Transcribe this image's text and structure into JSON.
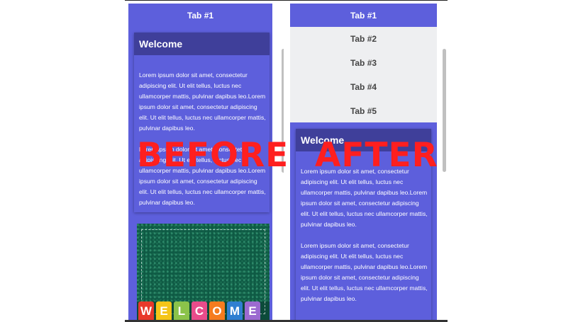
{
  "before": {
    "tab_label": "Tab #1",
    "card_title": "Welcome",
    "paragraphs": [
      "Lorem ipsum dolor sit amet, consectetur adipiscing elit. Ut elit tellus, luctus nec ullamcorper mattis, pulvinar dapibus leo.Lorem ipsum dolor sit amet, consectetur adipiscing elit. Ut elit tellus, luctus nec ullamcorper mattis, pulvinar dapibus leo.",
      "Lorem ipsum dolor sit amet, consectetur adipiscing elit. Ut elit tellus, luctus nec ullamcorper mattis, pulvinar dapibus leo.Lorem ipsum dolor sit amet, consectetur adipiscing elit. Ut elit tellus, luctus nec ullamcorper mattis, pulvinar dapibus leo."
    ],
    "image_letters": [
      "W",
      "E",
      "L",
      "C",
      "O",
      "M",
      "E"
    ],
    "image_letter_colors": [
      "#e8392b",
      "#f5c518",
      "#8bc34a",
      "#e84c8b",
      "#f57c1f",
      "#2f7fd1",
      "#9c6ad0"
    ],
    "label": "BEFORE"
  },
  "after": {
    "tabs": [
      "Tab #1",
      "Tab #2",
      "Tab #3",
      "Tab #4",
      "Tab #5"
    ],
    "active_tab": "Tab #1",
    "card_title": "Welcome",
    "paragraphs": [
      "Lorem ipsum dolor sit amet, consectetur adipiscing elit. Ut elit tellus, luctus nec ullamcorper mattis, pulvinar dapibus leo.Lorem ipsum dolor sit amet, consectetur adipiscing elit. Ut elit tellus, luctus nec ullamcorper mattis, pulvinar dapibus leo.",
      "Lorem ipsum dolor sit amet, consectetur adipiscing elit. Ut elit tellus, luctus nec ullamcorper mattis, pulvinar dapibus leo.Lorem ipsum dolor sit amet, consectetur adipiscing elit. Ut elit tellus, luctus nec ullamcorper mattis, pulvinar dapibus leo."
    ],
    "label": "AFTER"
  },
  "colors": {
    "accent": "#5d5fdc",
    "card_header": "#3f3f9a",
    "tab_inactive_bg": "#eeeff1",
    "label_red": "#ff1f1f"
  }
}
